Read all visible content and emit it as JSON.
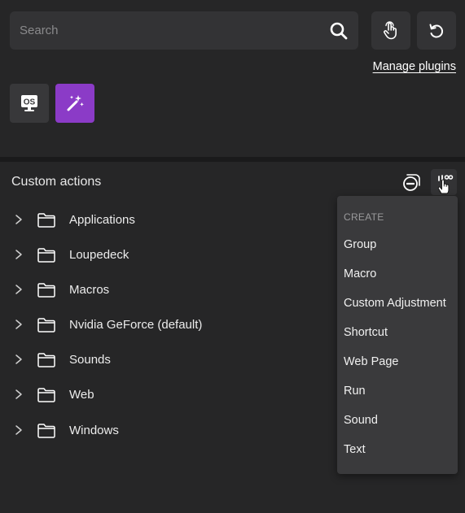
{
  "search": {
    "placeholder": "Search",
    "value": ""
  },
  "toolbar": {
    "touch_icon": "hand-pointer-icon",
    "refresh_icon": "refresh-icon"
  },
  "plugins": {
    "manage_label": "Manage plugins",
    "tiles": [
      {
        "icon": "os-monitor-icon",
        "background": "#38383a"
      },
      {
        "icon": "magic-wand-icon",
        "background": "#8b3bc7"
      }
    ]
  },
  "custom_actions": {
    "title": "Custom actions",
    "collapse_icon": "collapse-icon",
    "add_icon": "add-action-icon",
    "folders": [
      {
        "label": "Applications"
      },
      {
        "label": "Loupedeck"
      },
      {
        "label": "Macros"
      },
      {
        "label": "Nvidia GeForce (default)"
      },
      {
        "label": "Sounds"
      },
      {
        "label": "Web"
      },
      {
        "label": "Windows"
      }
    ]
  },
  "create_menu": {
    "header": "CREATE",
    "items": [
      "Group",
      "Macro",
      "Custom Adjustment",
      "Shortcut",
      "Web Page",
      "Run",
      "Sound",
      "Text"
    ]
  }
}
